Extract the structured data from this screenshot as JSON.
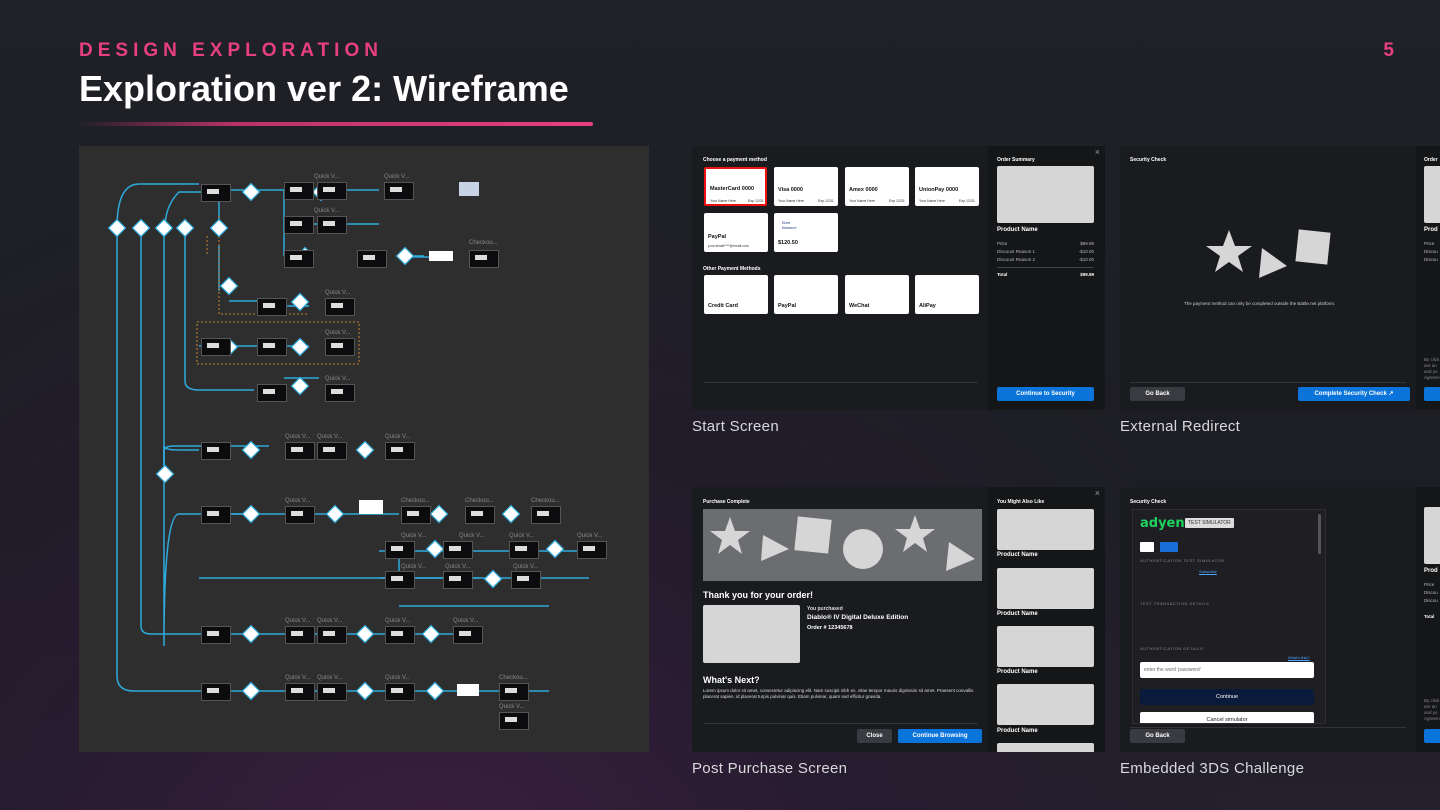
{
  "header": {
    "eyebrow": "DESIGN EXPLORATION",
    "title": "Exploration ver 2: Wireframe",
    "page_number": "5"
  },
  "flow": {
    "quick_view": "Quick V...",
    "checkout": "Checkou..."
  },
  "start_screen": {
    "caption": "Start Screen",
    "choose_title": "Choose a payment method",
    "cards": [
      {
        "name": "MasterCard 0000",
        "holder": "Your Name Here",
        "exp": "Exp 12/31"
      },
      {
        "name": "Visa 0000",
        "holder": "Your Name Here",
        "exp": "Exp 12/31"
      },
      {
        "name": "Amex 0000",
        "holder": "Your Name Here",
        "exp": "Exp 12/31"
      },
      {
        "name": "UnionPay 0000",
        "holder": "Your Name Here",
        "exp": "Exp 12/31"
      }
    ],
    "paypal": {
      "name": "PayPal",
      "email": "your.email****@email.com"
    },
    "balance": {
      "logo": "Bnet Balance",
      "amount": "$120.50"
    },
    "other_title": "Other Payment Methods",
    "other": [
      "Credit Card",
      "PayPal",
      "WeChat",
      "AliPay"
    ],
    "summary_title": "Order Summary",
    "product_name": "Product Name",
    "rows": [
      {
        "label": "Price",
        "value": "$99.99"
      },
      {
        "label": "Discount Reason 1",
        "value": "-$10.00"
      },
      {
        "label": "Discount Reason 2",
        "value": "-$10.00"
      }
    ],
    "total_label": "Total",
    "total_value": "$99.99",
    "continue_btn": "Continue to Security",
    "close": "×"
  },
  "redirect": {
    "caption": "External Redirect",
    "title": "Security Check",
    "message": "The payment method can only be completed outside the Battle.net platform.",
    "back_btn": "Go Back",
    "complete_btn": "Complete Security Check",
    "side_title": "Order",
    "side_prod": "Prod",
    "side_rows": [
      "Price",
      "Discou",
      "Discou"
    ],
    "side_legal": [
      "By click",
      "are an",
      "and yo",
      "Agreem"
    ]
  },
  "post": {
    "caption": "Post Purchase Screen",
    "title": "Purchase Complete",
    "thanks": "Thank you for your order!",
    "you_purchased": "You purchased",
    "product": "Diablo® IV Digital Deluxe Edition",
    "order": "Order # 12345678",
    "next_title": "What's Next?",
    "lorem": "Lorem ipsum dolor sit amet, consectetur adipiscing elit. Nam suscipit nibh ex, vitae tempor mauris dignissim sit amet. Praesent convallis placerat sapien, id placerat turpis pulvinar quis. Etiam pulvinar, quam sed efficitur gravida.",
    "close_btn": "Close",
    "continue_btn": "Continue Browsing",
    "side_title": "You Might Also Like",
    "side_items": [
      "Product Name",
      "Product Name",
      "Product Name",
      "Product Name"
    ],
    "close": "×"
  },
  "challenge": {
    "caption": "Embedded 3DS Challenge",
    "title": "Security Check",
    "brand": "adyen",
    "badge": "TEST SIMULATOR",
    "auth_sim": "AUTHENTICATION TEST SIMULATOR",
    "link": "Subscribe",
    "ttd": "TEST TRANSACTION DETAILS",
    "auth_details": "AUTHENTICATION DETAILS",
    "whats_this": "What's this?",
    "placeholder": "enter the word 'password'",
    "continue_btn": "Continue",
    "cancel_btn": "Cancel simulator",
    "back_btn": "Go Back",
    "side_prod": "Prod",
    "side_rows": [
      "Price",
      "Discou",
      "Discou"
    ],
    "side_total": "Total",
    "side_legal": [
      "By click",
      "are an",
      "and yo",
      "Agreem"
    ]
  },
  "colors": {
    "accent": "#e8407e",
    "blue": "#0a74da",
    "flow_line": "#2eaadc"
  }
}
